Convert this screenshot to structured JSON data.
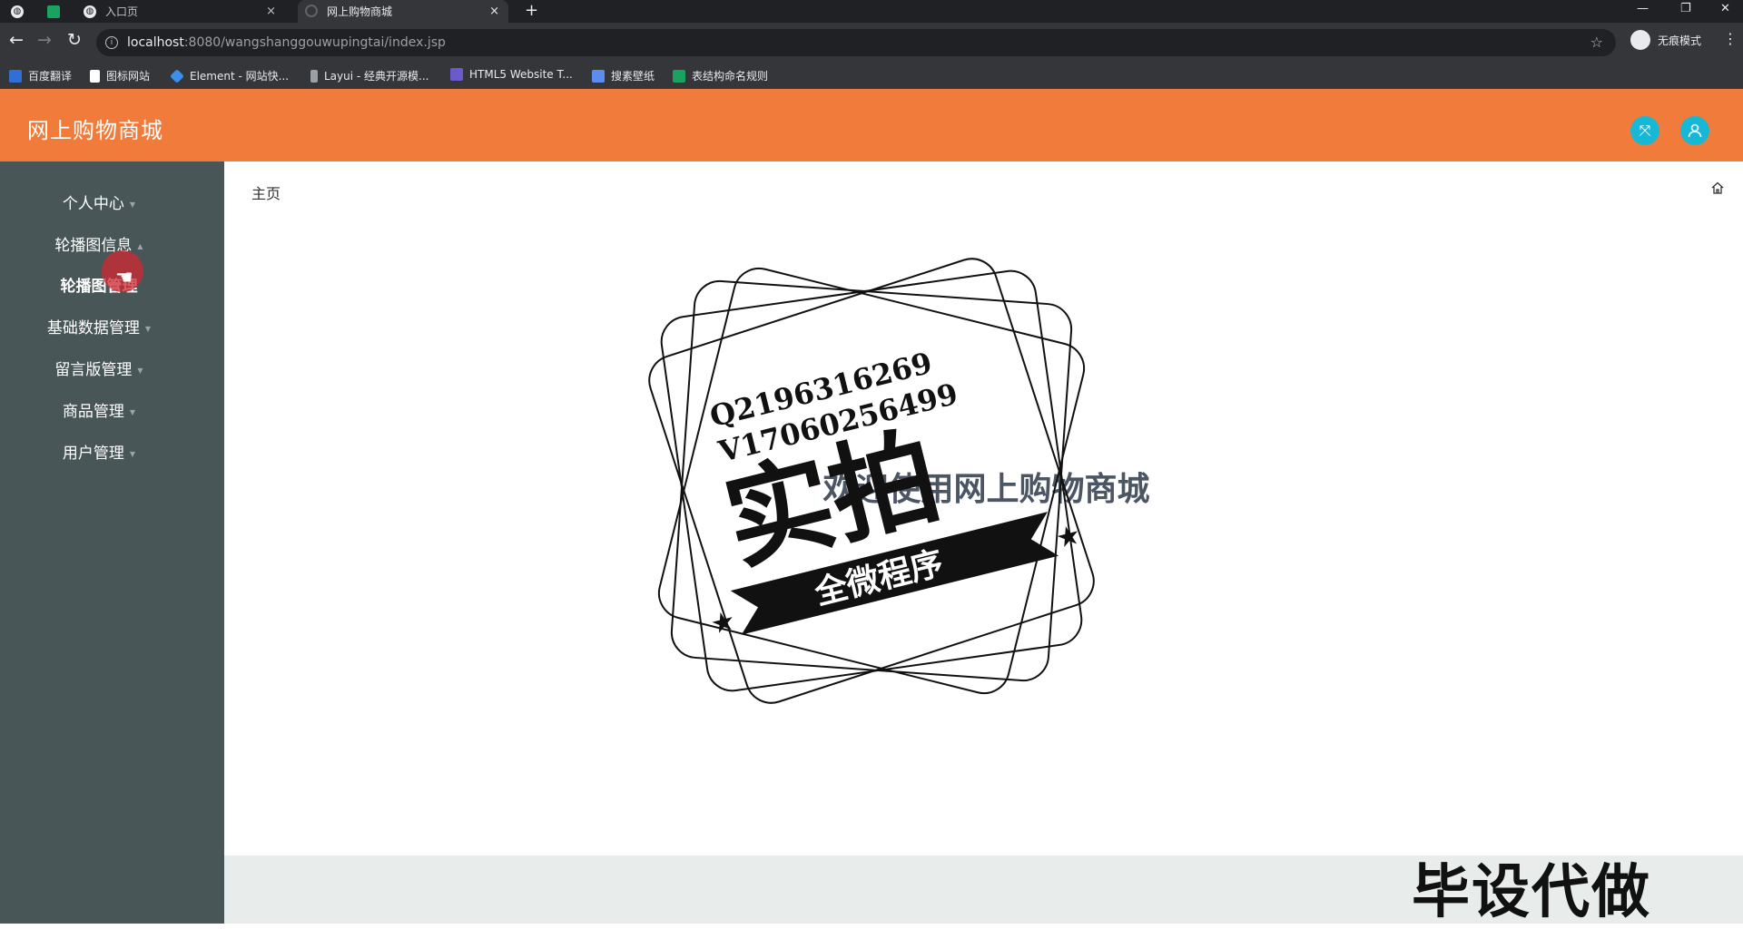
{
  "browser": {
    "tabs": [
      {
        "label": "",
        "icon": "globe-icon"
      },
      {
        "label": "",
        "icon": "sheet-icon"
      },
      {
        "label": "入口页",
        "icon": "globe-icon",
        "close": "×"
      },
      {
        "label": "网上购物商城",
        "icon": "loading-icon",
        "close": "×"
      }
    ],
    "new_tab": "+",
    "window_controls": {
      "minimize": "—",
      "restore": "❐",
      "close": "✕"
    },
    "url_host": "localhost",
    "url_path": ":8080/wangshanggouwupingtai/index.jsp",
    "profile_label": "无痕模式",
    "bookmarks": [
      {
        "label": "百度翻译",
        "color": "#2f6fd6"
      },
      {
        "label": "图标网站",
        "color": "#ffffff"
      },
      {
        "label": "Element - 网站快...",
        "color": "#3d8ee8"
      },
      {
        "label": "Layui - 经典开源模...",
        "color": "#9aa0a6"
      },
      {
        "label": "HTML5 Website T...",
        "color": "#6a5acd"
      },
      {
        "label": "搜素壁纸",
        "color": "#5b8def"
      },
      {
        "label": "表结构命名规则",
        "color": "#1aa260"
      }
    ]
  },
  "app": {
    "title": "网上购物商城",
    "header_color": "#f07b3a",
    "header_buttons": [
      {
        "icon": "fullscreen-icon"
      },
      {
        "icon": "user-icon"
      }
    ]
  },
  "sidebar": {
    "items": [
      {
        "label": "个人中心",
        "sub": false
      },
      {
        "label": "轮播图信息",
        "sub": false
      },
      {
        "label": "轮播图管理",
        "sub": true
      },
      {
        "label": "基础数据管理",
        "sub": false
      },
      {
        "label": "留言版管理",
        "sub": false
      },
      {
        "label": "商品管理",
        "sub": false
      },
      {
        "label": "用户管理",
        "sub": false
      }
    ]
  },
  "main": {
    "breadcrumb": "主页",
    "welcome": "欢迎使用网上购物商城"
  },
  "watermark": {
    "line1": "Q2196316269",
    "line2": "V17060256499",
    "big": "实拍",
    "ribbon": "全微程序",
    "bottom": "毕设代做"
  }
}
